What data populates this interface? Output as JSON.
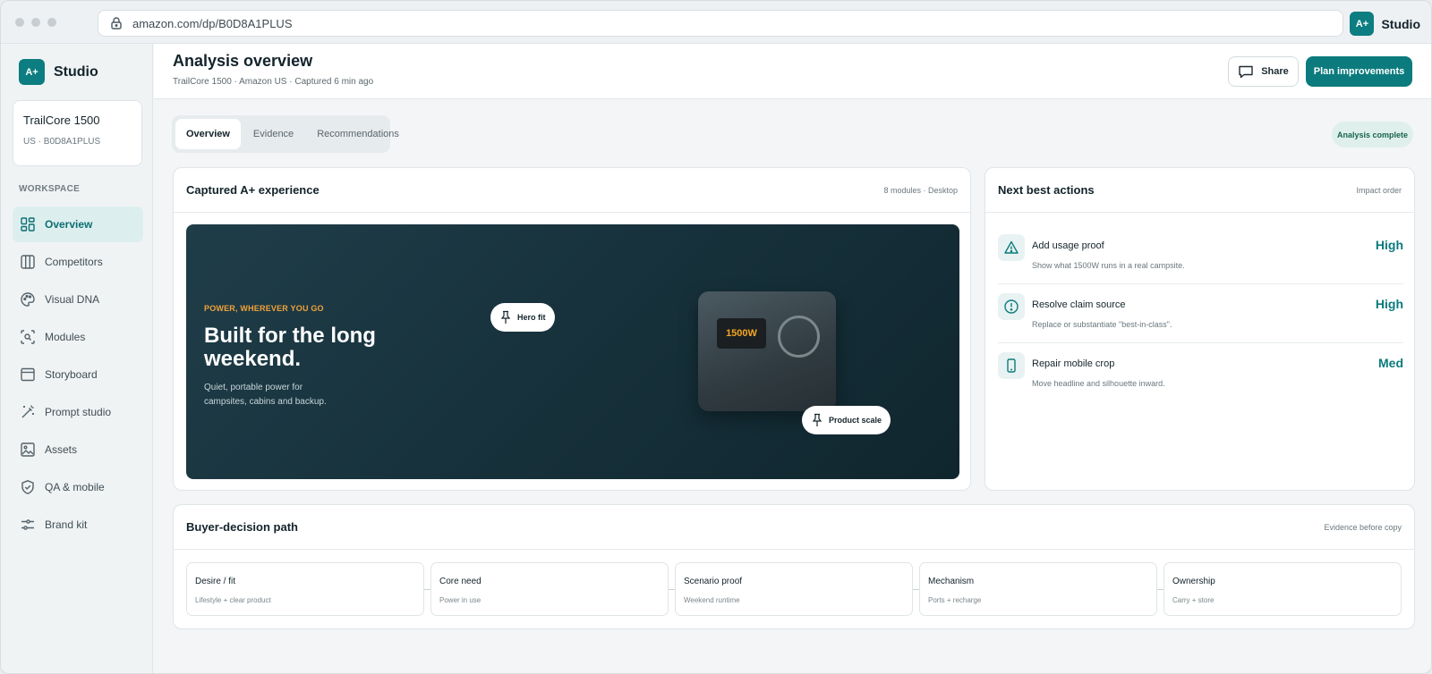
{
  "browser": {
    "url": "amazon.com/dp/B0D8A1PLUS",
    "brand": "Studio",
    "logo": "A+"
  },
  "sidebar": {
    "brand": "Studio",
    "logo": "A+",
    "product": {
      "name": "TrailCore 1500",
      "id": "US · B0D8A1PLUS"
    },
    "section_label": "WORKSPACE",
    "items": [
      {
        "label": "Overview",
        "icon": "grid-icon",
        "active": true
      },
      {
        "label": "Competitors",
        "icon": "columns-icon"
      },
      {
        "label": "Visual DNA",
        "icon": "palette-icon"
      },
      {
        "label": "Modules",
        "icon": "scan-icon"
      },
      {
        "label": "Storyboard",
        "icon": "storyboard-icon"
      },
      {
        "label": "Prompt studio",
        "icon": "wand-icon"
      },
      {
        "label": "Assets",
        "icon": "image-icon"
      },
      {
        "label": "QA & mobile",
        "icon": "shield-check-icon"
      },
      {
        "label": "Brand kit",
        "icon": "sliders-icon"
      }
    ]
  },
  "header": {
    "title": "Analysis overview",
    "subtitle": "TrailCore 1500 · Amazon US · Captured 6 min ago",
    "share_label": "Share",
    "plan_label": "Plan improvements"
  },
  "tabs": [
    {
      "label": "Overview",
      "active": true
    },
    {
      "label": "Evidence"
    },
    {
      "label": "Recommendations"
    }
  ],
  "status_badge": "Analysis complete",
  "captured": {
    "title": "Captured A+ experience",
    "meta": "8 modules · Desktop",
    "hero": {
      "kicker": "POWER, WHEREVER YOU GO",
      "headline": "Built for the long weekend.",
      "body": "Quiet, portable power for campsites, cabins and backup.",
      "device_label": "1500W",
      "pin_hero": "Hero fit",
      "pin_product": "Product scale"
    }
  },
  "actions": {
    "title": "Next best actions",
    "meta": "Impact order",
    "items": [
      {
        "title": "Add usage proof",
        "desc": "Show what 1500W runs in a real campsite.",
        "priority": "High",
        "icon": "warning-icon"
      },
      {
        "title": "Resolve claim source",
        "desc": "Replace or substantiate \"best-in-class\".",
        "priority": "High",
        "icon": "alert-circle-icon"
      },
      {
        "title": "Repair mobile crop",
        "desc": "Move headline and silhouette inward.",
        "priority": "Med",
        "icon": "mobile-icon"
      }
    ]
  },
  "path": {
    "title": "Buyer-decision path",
    "meta": "Evidence before copy",
    "steps": [
      {
        "title": "Desire / fit",
        "desc": "Lifestyle + clear product"
      },
      {
        "title": "Core need",
        "desc": "Power in use"
      },
      {
        "title": "Scenario proof",
        "desc": "Weekend runtime"
      },
      {
        "title": "Mechanism",
        "desc": "Ports + recharge"
      },
      {
        "title": "Ownership",
        "desc": "Carry + store"
      }
    ]
  },
  "colors": {
    "accent": "#0c7b7e",
    "hero_bg": "#16303a",
    "kicker": "#f2a23a"
  }
}
